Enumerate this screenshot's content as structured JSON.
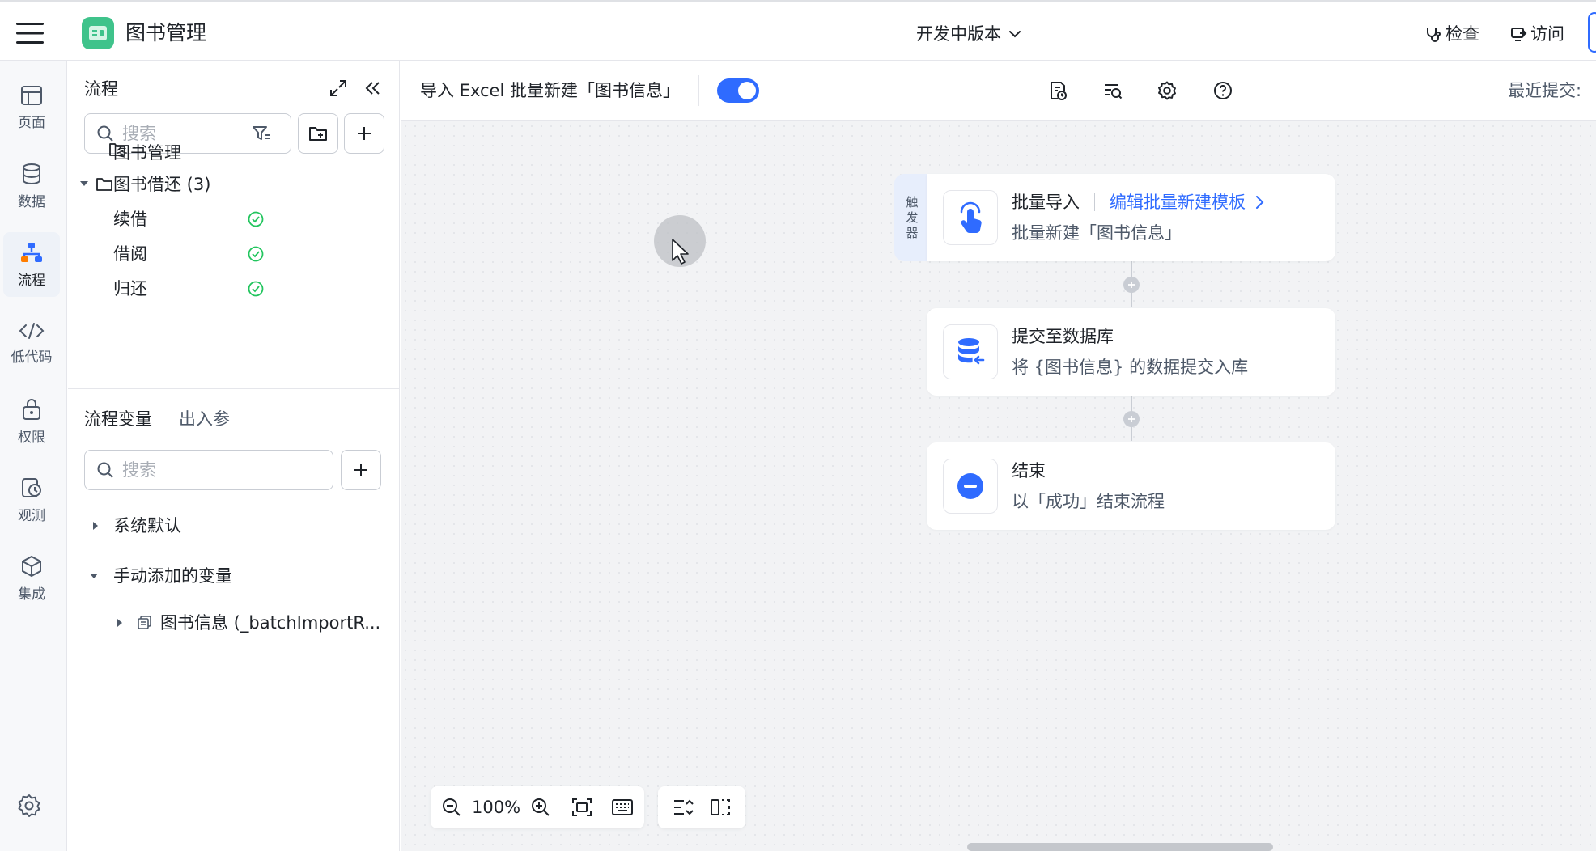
{
  "header": {
    "app_title": "图书管理",
    "version_label": "开发中版本",
    "check_label": "检查",
    "visit_label": "访问"
  },
  "rail": {
    "items": [
      {
        "label": "页面",
        "icon": "page-icon"
      },
      {
        "label": "数据",
        "icon": "database-icon"
      },
      {
        "label": "流程",
        "icon": "flow-icon",
        "active": true
      },
      {
        "label": "低代码",
        "icon": "code-icon"
      },
      {
        "label": "权限",
        "icon": "lock-icon"
      },
      {
        "label": "观测",
        "icon": "monitor-icon"
      },
      {
        "label": "集成",
        "icon": "cube-icon"
      }
    ]
  },
  "flows_panel": {
    "title": "流程",
    "search_placeholder": "搜索",
    "tree": [
      {
        "label": "图书管理",
        "type": "folder"
      },
      {
        "label": "图书借还 (3)",
        "type": "folder",
        "expanded": true
      },
      {
        "label": "续借",
        "status": "success"
      },
      {
        "label": "借阅",
        "status": "success"
      },
      {
        "label": "归还",
        "status": "success"
      }
    ]
  },
  "vars_panel": {
    "tabs": [
      "流程变量",
      "出入参"
    ],
    "search_placeholder": "搜索",
    "groups": [
      {
        "label": "系统默认",
        "expanded": false
      },
      {
        "label": "手动添加的变量",
        "expanded": true
      }
    ],
    "variables": [
      {
        "label": "图书信息 (_batchImportR..."
      }
    ]
  },
  "toolbar": {
    "flow_name": "导入 Excel 批量新建「图书信息」",
    "enabled": true,
    "last_submit_label": "最近提交:"
  },
  "canvas": {
    "trigger_tag": [
      "触",
      "发",
      "器"
    ],
    "nodes": [
      {
        "title": "批量导入",
        "link": "编辑批量新建模板",
        "subtitle": "批量新建「图书信息」",
        "icon": "hand-pointer-icon"
      },
      {
        "title": "提交至数据库",
        "subtitle": "将 {图书信息} 的数据提交入库",
        "icon": "database-import-icon"
      },
      {
        "title": "结束",
        "subtitle": "以「成功」结束流程",
        "icon": "end-icon"
      }
    ],
    "zoom": "100%"
  },
  "colors": {
    "primary": "#2f6bff",
    "success": "#22c55e",
    "logo": "#3fc38b"
  }
}
